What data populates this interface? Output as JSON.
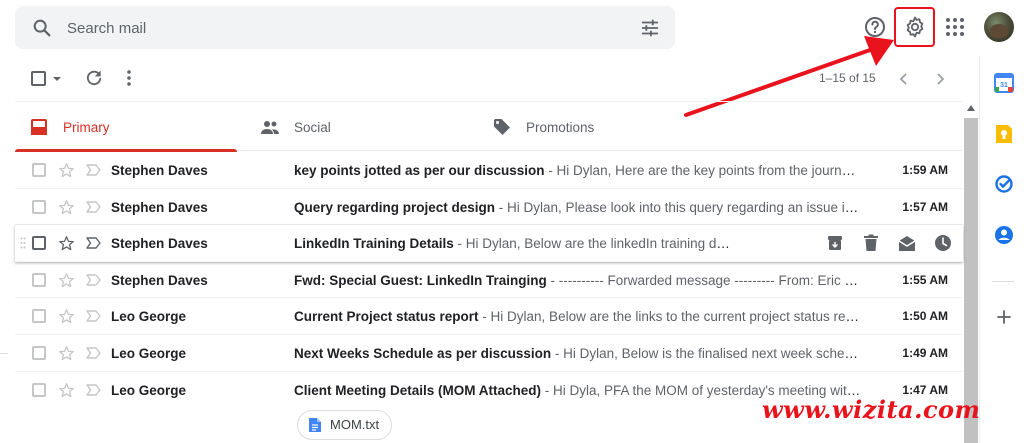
{
  "search": {
    "placeholder": "Search mail"
  },
  "toolbar": {
    "page_count": "1–15 of 15"
  },
  "tabs": [
    {
      "label": "Primary",
      "icon": "inbox-icon"
    },
    {
      "label": "Social",
      "icon": "people-icon"
    },
    {
      "label": "Promotions",
      "icon": "tag-icon"
    }
  ],
  "emails": [
    {
      "sender": "Stephen Daves",
      "subject": "key points jotted as per our discussion",
      "snippet": " - Hi Dylan, Here are the key points from the journal as per our discussion",
      "time": "1:59 AM"
    },
    {
      "sender": "Stephen Daves",
      "subject": "Query regarding project design",
      "snippet": " - Hi Dylan, Please look into this query regarding an issue in project design",
      "time": "1:57 AM"
    },
    {
      "sender": "Stephen Daves",
      "subject": "LinkedIn Training Details",
      "snippet": " - Hi Dylan, Below are the linkedIn training details",
      "time": ""
    },
    {
      "sender": "Stephen Daves",
      "subject": "Fwd: Special Guest: LinkedIn Trainging",
      "snippet": " - ---------- Forwarded message --------- From: Eric Louviere",
      "time": "1:55 AM"
    },
    {
      "sender": "Leo George",
      "subject": "Current Project status report",
      "snippet": " - Hi Dylan, Below are the links to the current project status report for review",
      "time": "1:50 AM"
    },
    {
      "sender": "Leo George",
      "subject": "Next Weeks Schedule as per discussion",
      "snippet": " - Hi Dylan, Below is the finalised next week schedule as discussed",
      "time": "1:49 AM"
    },
    {
      "sender": "Leo George",
      "subject": "Client Meeting Details (MOM Attached)",
      "snippet": " - Hi Dyla, PFA the MOM of yesterday's meeting with the client",
      "time": "1:47 AM",
      "attachment": "MOM.txt"
    }
  ],
  "watermark": "www.wizita.com",
  "colors": {
    "primary_accent": "#d93025",
    "highlight": "#e8131c"
  }
}
